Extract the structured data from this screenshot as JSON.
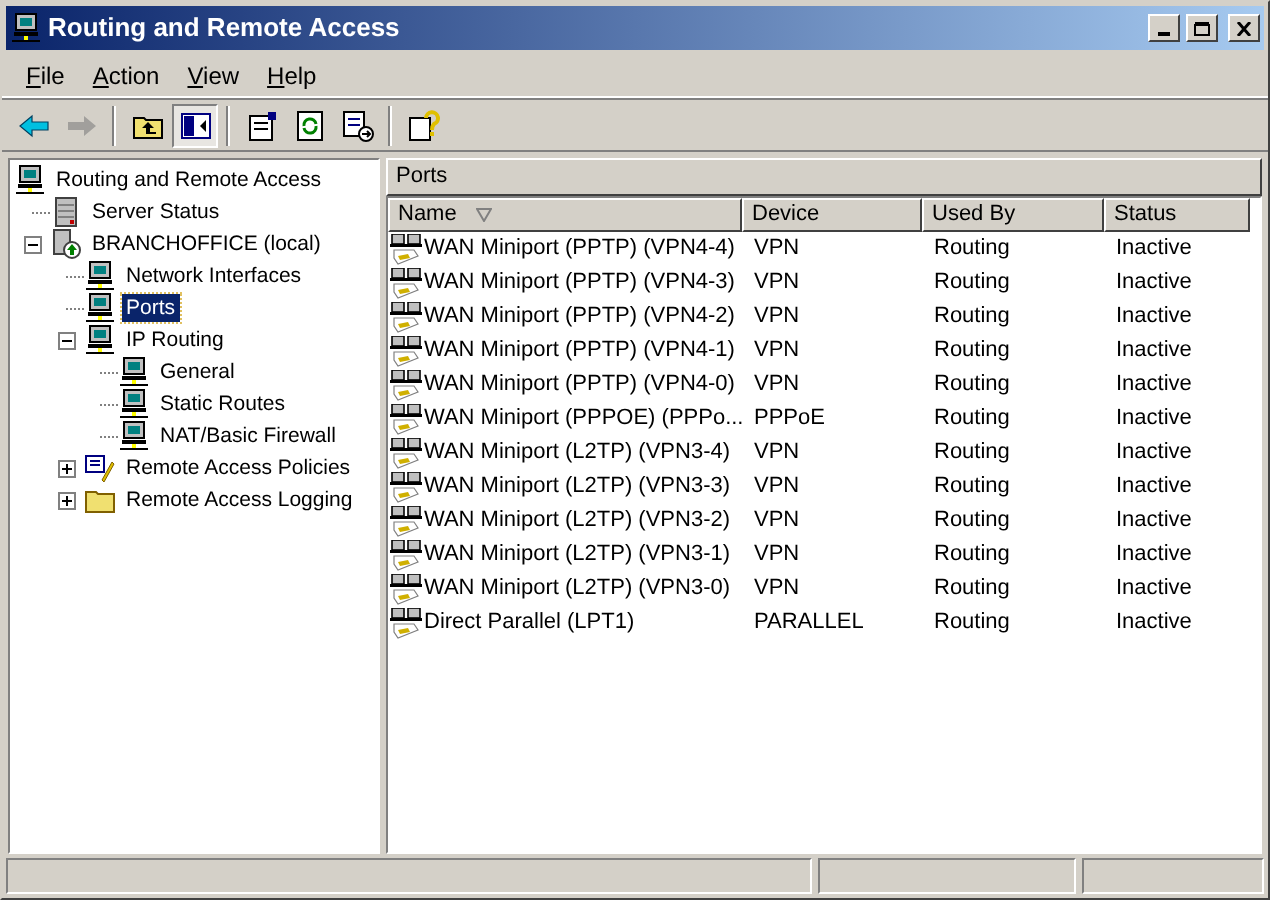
{
  "window": {
    "title": "Routing and Remote Access"
  },
  "menu": [
    {
      "label": "File"
    },
    {
      "label": "Action"
    },
    {
      "label": "View"
    },
    {
      "label": "Help"
    }
  ],
  "toolbar": [
    {
      "kind": "back",
      "disabled": false,
      "pressed": false
    },
    {
      "kind": "forward",
      "disabled": true,
      "pressed": false
    },
    {
      "kind": "sep"
    },
    {
      "kind": "up",
      "disabled": false,
      "pressed": false
    },
    {
      "kind": "tree",
      "disabled": false,
      "pressed": true
    },
    {
      "kind": "sep"
    },
    {
      "kind": "properties",
      "disabled": false,
      "pressed": false
    },
    {
      "kind": "refresh",
      "disabled": false,
      "pressed": false
    },
    {
      "kind": "export",
      "disabled": false,
      "pressed": false
    },
    {
      "kind": "sep"
    },
    {
      "kind": "help",
      "disabled": false,
      "pressed": false
    }
  ],
  "tree": [
    {
      "label": "Routing and Remote Access",
      "kind": "computer",
      "selected": false,
      "children": [
        {
          "label": "Server Status",
          "kind": "server",
          "selected": false
        },
        {
          "label": "BRANCHOFFICE (local)",
          "kind": "branch",
          "selected": false,
          "expanded": true,
          "children": [
            {
              "label": "Network Interfaces",
              "kind": "computer",
              "selected": false
            },
            {
              "label": "Ports",
              "kind": "computer",
              "selected": true
            },
            {
              "label": "IP Routing",
              "kind": "computer",
              "selected": false,
              "expanded": true,
              "children": [
                {
                  "label": "General",
                  "kind": "computer",
                  "selected": false
                },
                {
                  "label": "Static Routes",
                  "kind": "computer",
                  "selected": false
                },
                {
                  "label": "NAT/Basic Firewall",
                  "kind": "computer",
                  "selected": false
                }
              ]
            },
            {
              "label": "Remote Access Policies",
              "kind": "policy",
              "selected": false,
              "expanded": false
            },
            {
              "label": "Remote Access Logging",
              "kind": "folder",
              "selected": false,
              "expanded": false
            }
          ]
        }
      ]
    }
  ],
  "pane": {
    "title": "Ports"
  },
  "table": {
    "columns": [
      {
        "label": "Name",
        "sorted": true
      },
      {
        "label": "Device",
        "sorted": false
      },
      {
        "label": "Used By",
        "sorted": false
      },
      {
        "label": "Status",
        "sorted": false
      }
    ],
    "rows": [
      [
        "WAN Miniport (PPTP) (VPN4-4)",
        "VPN",
        "Routing",
        "Inactive"
      ],
      [
        "WAN Miniport (PPTP) (VPN4-3)",
        "VPN",
        "Routing",
        "Inactive"
      ],
      [
        "WAN Miniport (PPTP) (VPN4-2)",
        "VPN",
        "Routing",
        "Inactive"
      ],
      [
        "WAN Miniport (PPTP) (VPN4-1)",
        "VPN",
        "Routing",
        "Inactive"
      ],
      [
        "WAN Miniport (PPTP) (VPN4-0)",
        "VPN",
        "Routing",
        "Inactive"
      ],
      [
        "WAN Miniport (PPPOE) (PPPo...",
        "PPPoE",
        "Routing",
        "Inactive"
      ],
      [
        "WAN Miniport (L2TP) (VPN3-4)",
        "VPN",
        "Routing",
        "Inactive"
      ],
      [
        "WAN Miniport (L2TP) (VPN3-3)",
        "VPN",
        "Routing",
        "Inactive"
      ],
      [
        "WAN Miniport (L2TP) (VPN3-2)",
        "VPN",
        "Routing",
        "Inactive"
      ],
      [
        "WAN Miniport (L2TP) (VPN3-1)",
        "VPN",
        "Routing",
        "Inactive"
      ],
      [
        "WAN Miniport (L2TP) (VPN3-0)",
        "VPN",
        "Routing",
        "Inactive"
      ],
      [
        "Direct Parallel (LPT1)",
        "PARALLEL",
        "Routing",
        "Inactive"
      ]
    ]
  }
}
